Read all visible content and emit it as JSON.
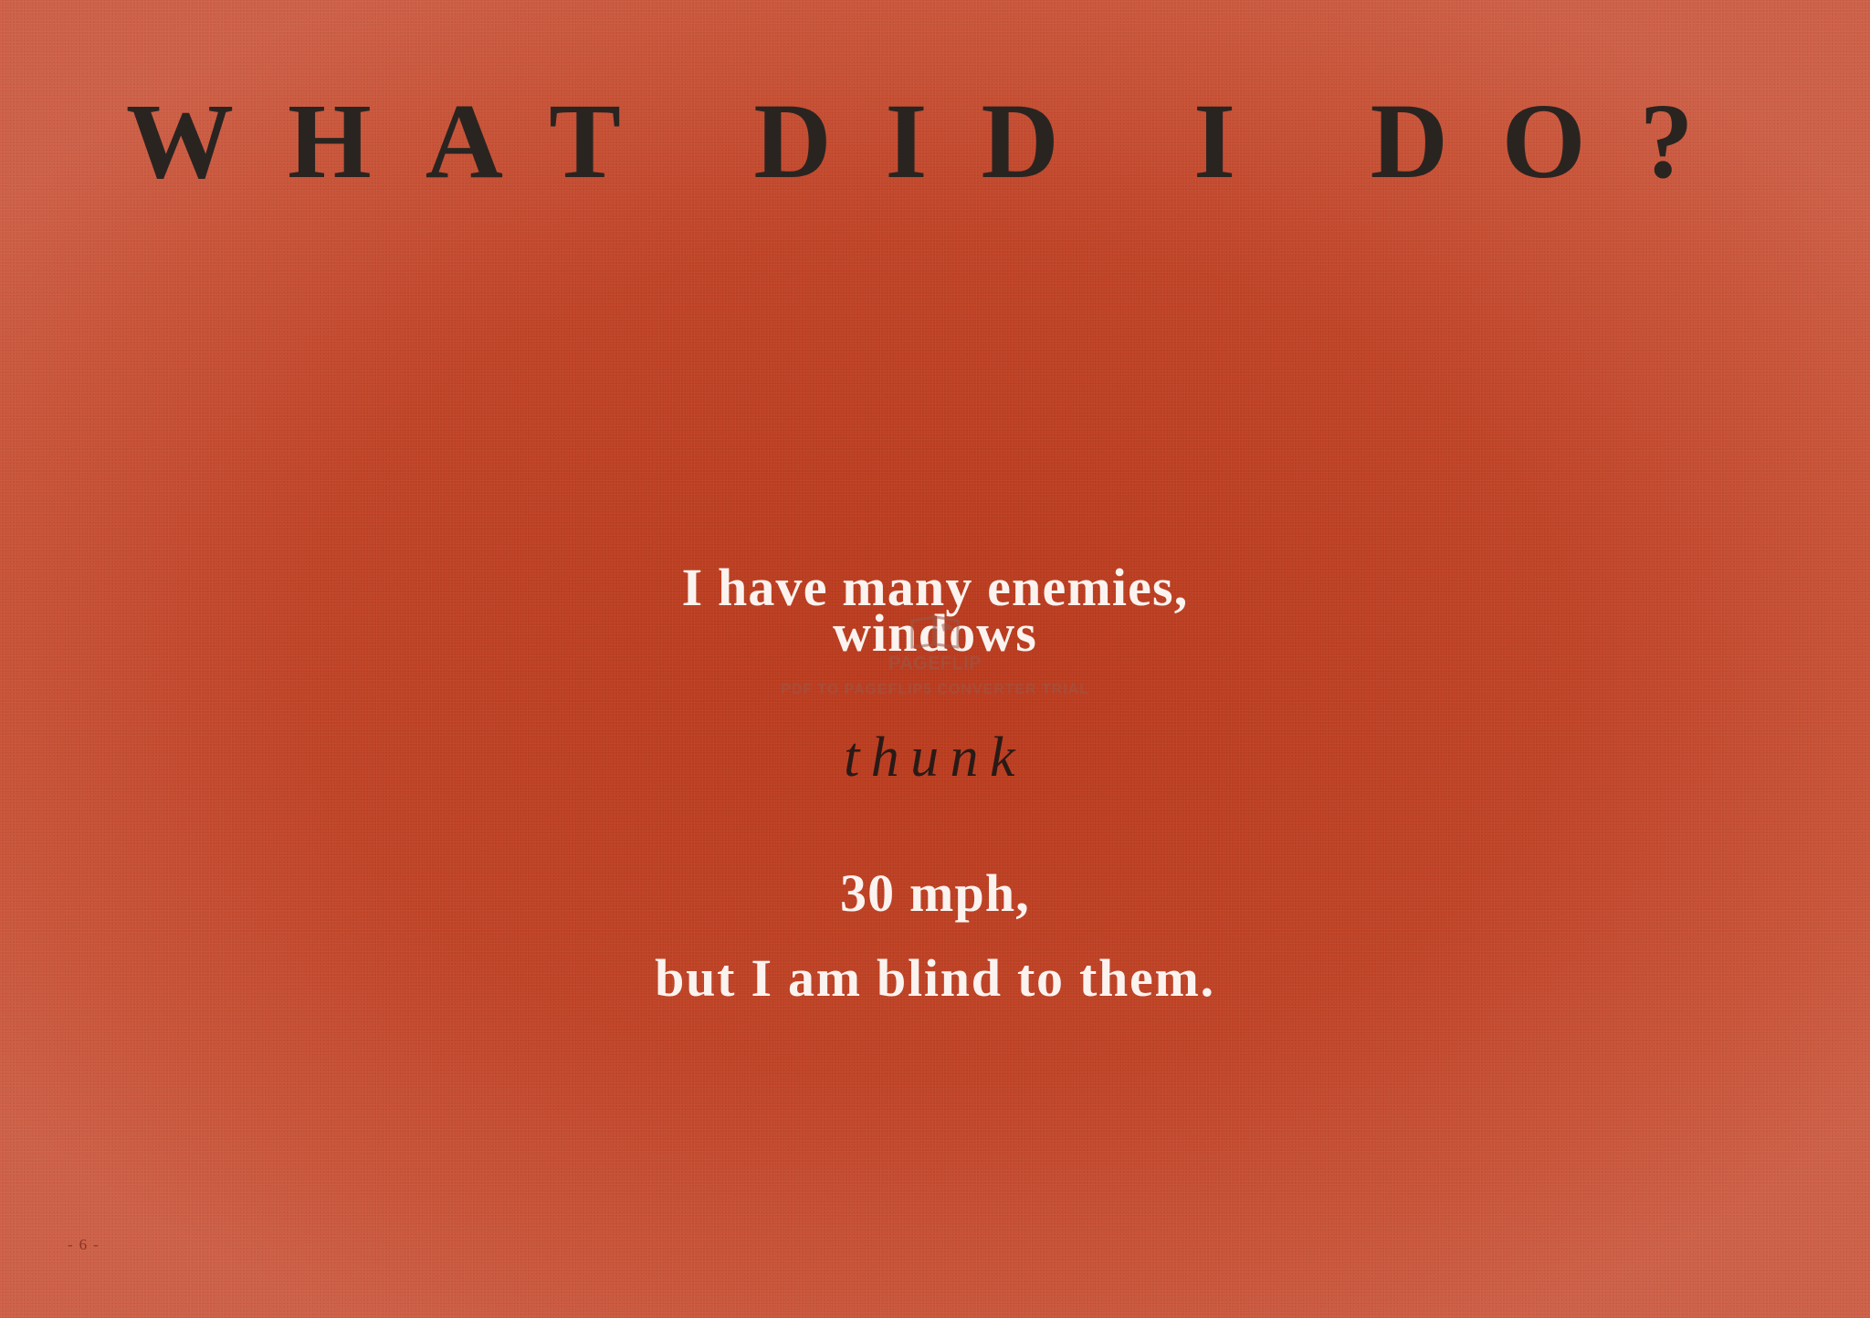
{
  "heading": "WHAT DID I DO?",
  "body": {
    "line1": "I have many enemies,",
    "line2": "windows",
    "line3": "thunk",
    "line4": "30 mph,",
    "line5": "but I am blind to them."
  },
  "watermark": {
    "icon": "book-icon",
    "brand": "PAGEFLIP",
    "caption": "PDF TO PAGEFLIP5 CONVERTER TRIAL"
  },
  "footer": {
    "page_number": "- 6 -"
  },
  "colors": {
    "background": "#c04326",
    "heading": "#2a2421",
    "body_text": "#fbf3ef",
    "italic_text": "#2a1a16"
  }
}
